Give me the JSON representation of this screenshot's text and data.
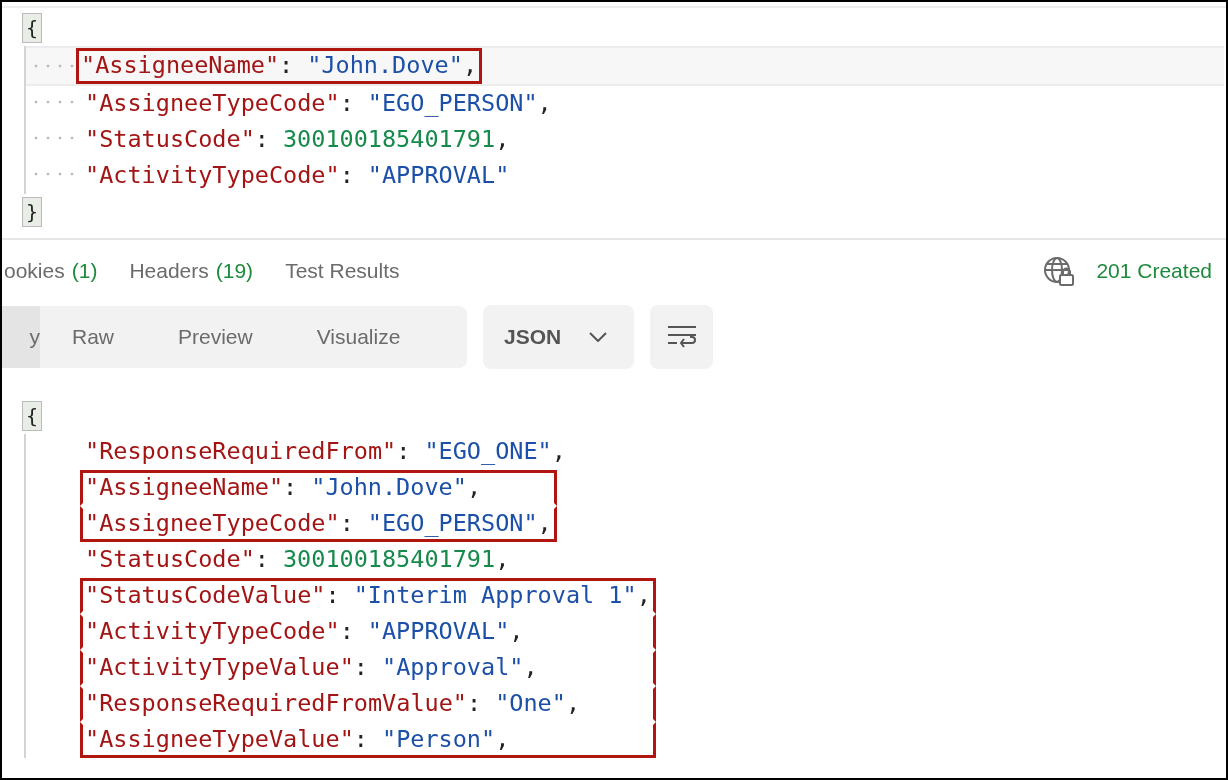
{
  "request_body": {
    "lines": [
      {
        "kind": "brace",
        "text": "{"
      },
      {
        "kind": "string",
        "key": "\"AssigneeName\"",
        "colon": ":",
        "value": "\"John.Dove\"",
        "comma": ",",
        "boxed": true,
        "current_line": true
      },
      {
        "kind": "string",
        "key": "\"AssigneeTypeCode\"",
        "colon": ":",
        "value": "\"EGO_PERSON\"",
        "comma": ",",
        "boxed": false,
        "current_line": false
      },
      {
        "kind": "number",
        "key": "\"StatusCode\"",
        "colon": ":",
        "value": "300100185401791",
        "comma": ",",
        "boxed": false,
        "current_line": false
      },
      {
        "kind": "string",
        "key": "\"ActivityTypeCode\"",
        "colon": ":",
        "value": "\"APPROVAL\"",
        "boxed": false,
        "current_line": false
      },
      {
        "kind": "brace",
        "text": "}"
      }
    ]
  },
  "response_tabs": [
    {
      "label": "ookies",
      "count": "(1)"
    },
    {
      "label": "Headers",
      "count": "(19)"
    },
    {
      "label": "Test Results"
    }
  ],
  "status": {
    "text": "201 Created"
  },
  "view_modes": [
    {
      "label": "y",
      "selected": true
    },
    {
      "label": "Raw",
      "selected": false
    },
    {
      "label": "Preview",
      "selected": false
    },
    {
      "label": "Visualize",
      "selected": false
    }
  ],
  "format_dropdown": {
    "value": "JSON"
  },
  "response_body": {
    "lines": [
      {
        "kind": "brace",
        "text": "{"
      },
      {
        "kind": "string",
        "key": "\"ResponseRequiredFrom\"",
        "colon": ":",
        "value": "\"EGO_ONE\"",
        "comma": ",",
        "boxed": false
      },
      {
        "kind": "string",
        "key": "\"AssigneeName\"",
        "colon": ":",
        "value": "\"John.Dove\"",
        "comma": ",",
        "boxed": true
      },
      {
        "kind": "string",
        "key": "\"AssigneeTypeCode\"",
        "colon": ":",
        "value": "\"EGO_PERSON\"",
        "comma": ",",
        "boxed": true
      },
      {
        "kind": "number",
        "key": "\"StatusCode\"",
        "colon": ":",
        "value": "300100185401791",
        "comma": ",",
        "boxed": false
      },
      {
        "kind": "string",
        "key": "\"StatusCodeValue\"",
        "colon": ":",
        "value": "\"Interim Approval 1\"",
        "comma": ",",
        "boxed": true
      },
      {
        "kind": "string",
        "key": "\"ActivityTypeCode\"",
        "colon": ":",
        "value": "\"APPROVAL\"",
        "comma": ",",
        "boxed": true
      },
      {
        "kind": "string",
        "key": "\"ActivityTypeValue\"",
        "colon": ":",
        "value": "\"Approval\"",
        "comma": ",",
        "boxed": true
      },
      {
        "kind": "string",
        "key": "\"ResponseRequiredFromValue\"",
        "colon": ":",
        "value": "\"One\"",
        "comma": ",",
        "boxed": true
      },
      {
        "kind": "string",
        "key": "\"AssigneeTypeValue\"",
        "colon": ":",
        "value": "\"Person\"",
        "comma": ",",
        "boxed": true
      }
    ]
  }
}
